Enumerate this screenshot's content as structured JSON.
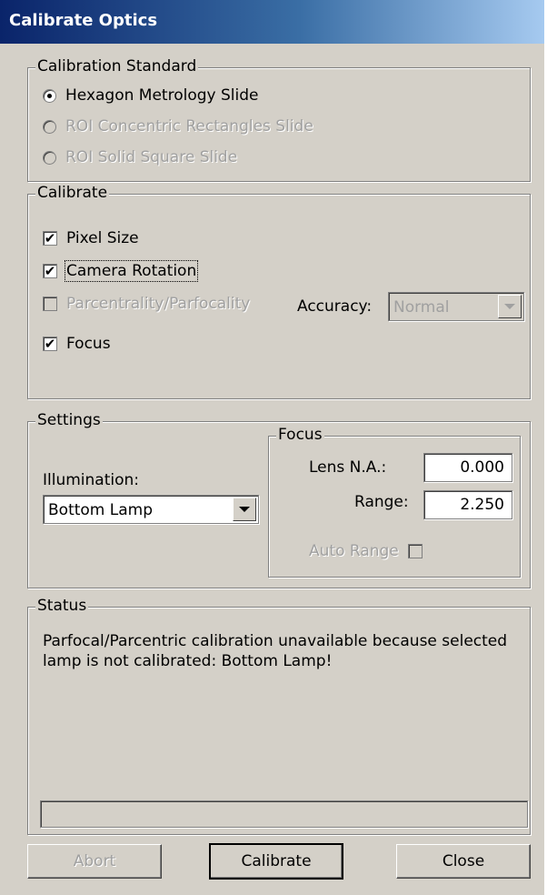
{
  "window": {
    "title": "Calibrate Optics"
  },
  "calibration_standard": {
    "legend": "Calibration Standard",
    "options": [
      {
        "label": "Hexagon Metrology Slide",
        "checked": true,
        "enabled": true
      },
      {
        "label": "ROI Concentric Rectangles Slide",
        "checked": false,
        "enabled": false
      },
      {
        "label": "ROI Solid Square Slide",
        "checked": false,
        "enabled": false
      }
    ]
  },
  "calibrate": {
    "legend": "Calibrate",
    "pixel_size": {
      "label": "Pixel Size",
      "checked": true
    },
    "camera_rotation": {
      "label": "Camera Rotation",
      "checked": true
    },
    "parcentrality": {
      "label": "Parcentrality/Parfocality",
      "checked": false,
      "enabled": false
    },
    "accuracy": {
      "label": "Accuracy:",
      "value": "Normal",
      "enabled": false
    },
    "focus": {
      "label": "Focus",
      "checked": true
    }
  },
  "settings": {
    "legend": "Settings",
    "illumination": {
      "label": "Illumination:",
      "value": "Bottom Lamp"
    },
    "focus_group": {
      "legend": "Focus",
      "lens_na": {
        "label": "Lens N.A.:",
        "value": "0.000"
      },
      "range": {
        "label": "Range:",
        "value": "2.250"
      },
      "auto_range": {
        "label": "Auto Range",
        "checked": false,
        "enabled": false
      }
    }
  },
  "status": {
    "legend": "Status",
    "message": "Parfocal/Parcentric calibration unavailable because selected lamp is not calibrated: Bottom Lamp!",
    "progress": 0
  },
  "buttons": {
    "abort": {
      "label": "Abort",
      "enabled": false
    },
    "calibrate": {
      "label": "Calibrate",
      "default": true
    },
    "close": {
      "label": "Close"
    }
  },
  "colors": {
    "title_gradient_start": "#0a246a",
    "title_gradient_end": "#a6caf0",
    "face": "#d4d0c8",
    "disabled_text": "#a0a0a0"
  }
}
